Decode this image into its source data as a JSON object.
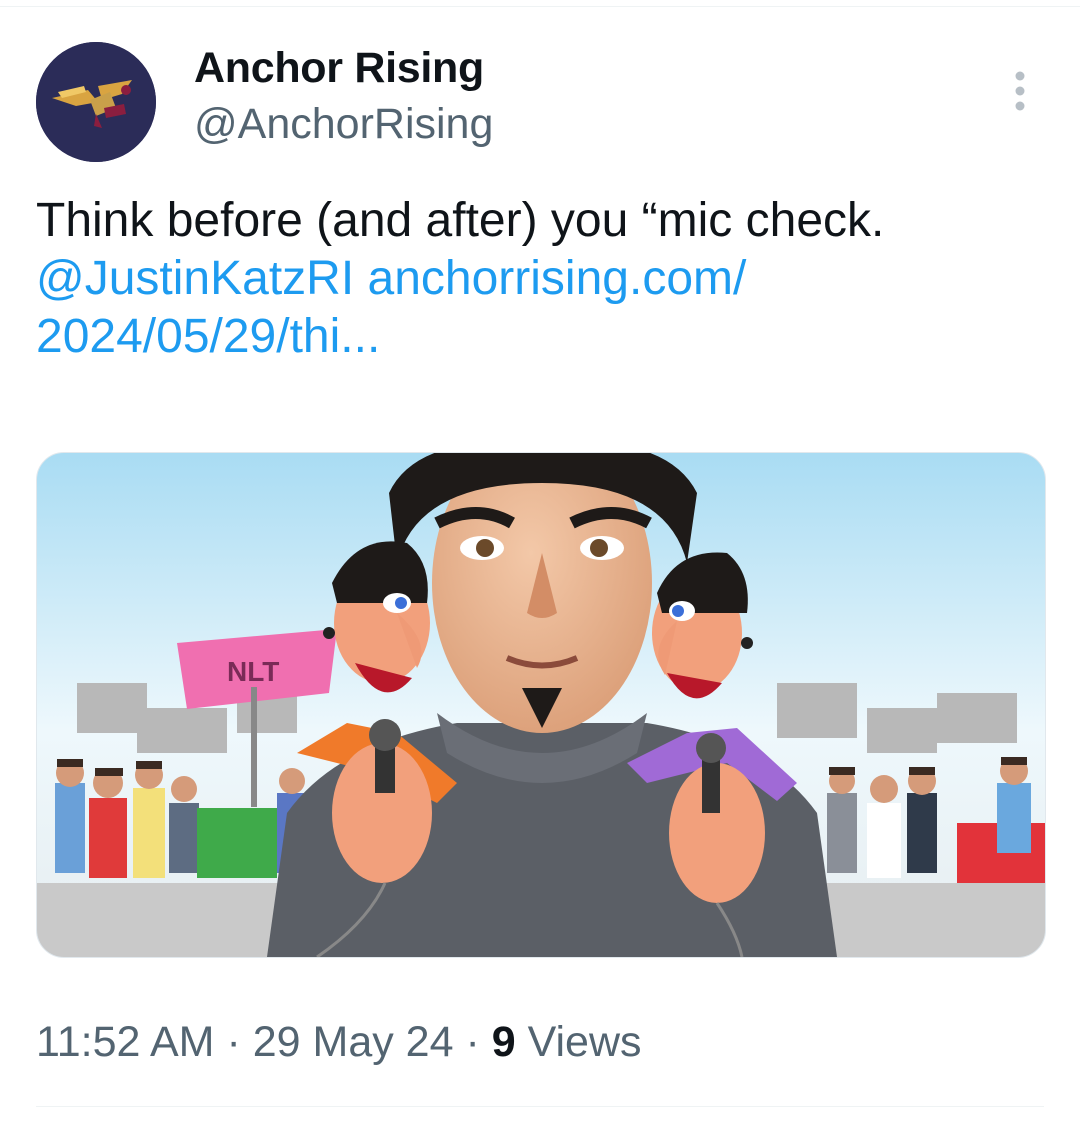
{
  "author": {
    "display_name": "Anchor Rising",
    "handle": "@AnchorRising",
    "avatar_icon": "eagle-anchor-logo-icon"
  },
  "menu": {
    "icon": "more-vertical-icon"
  },
  "tweet": {
    "text": "Think before (and after) you “mic check. ",
    "mention": "@JustinKatzRI",
    "link_line1": " anchorrising.com/",
    "link_line2": "2024/05/29/thi..."
  },
  "media": {
    "alt": "cartoon-man-holding-two-microphone-puppets",
    "sign_text": "NLT"
  },
  "meta": {
    "time": "11:52 AM",
    "sep1": " · ",
    "date": "29 May 24",
    "sep2": " · ",
    "views_count": "9",
    "views_label": " Views"
  },
  "colors": {
    "link": "#1d9bf0",
    "secondary_text": "#536471",
    "avatar_bg": "#2b2c58"
  }
}
